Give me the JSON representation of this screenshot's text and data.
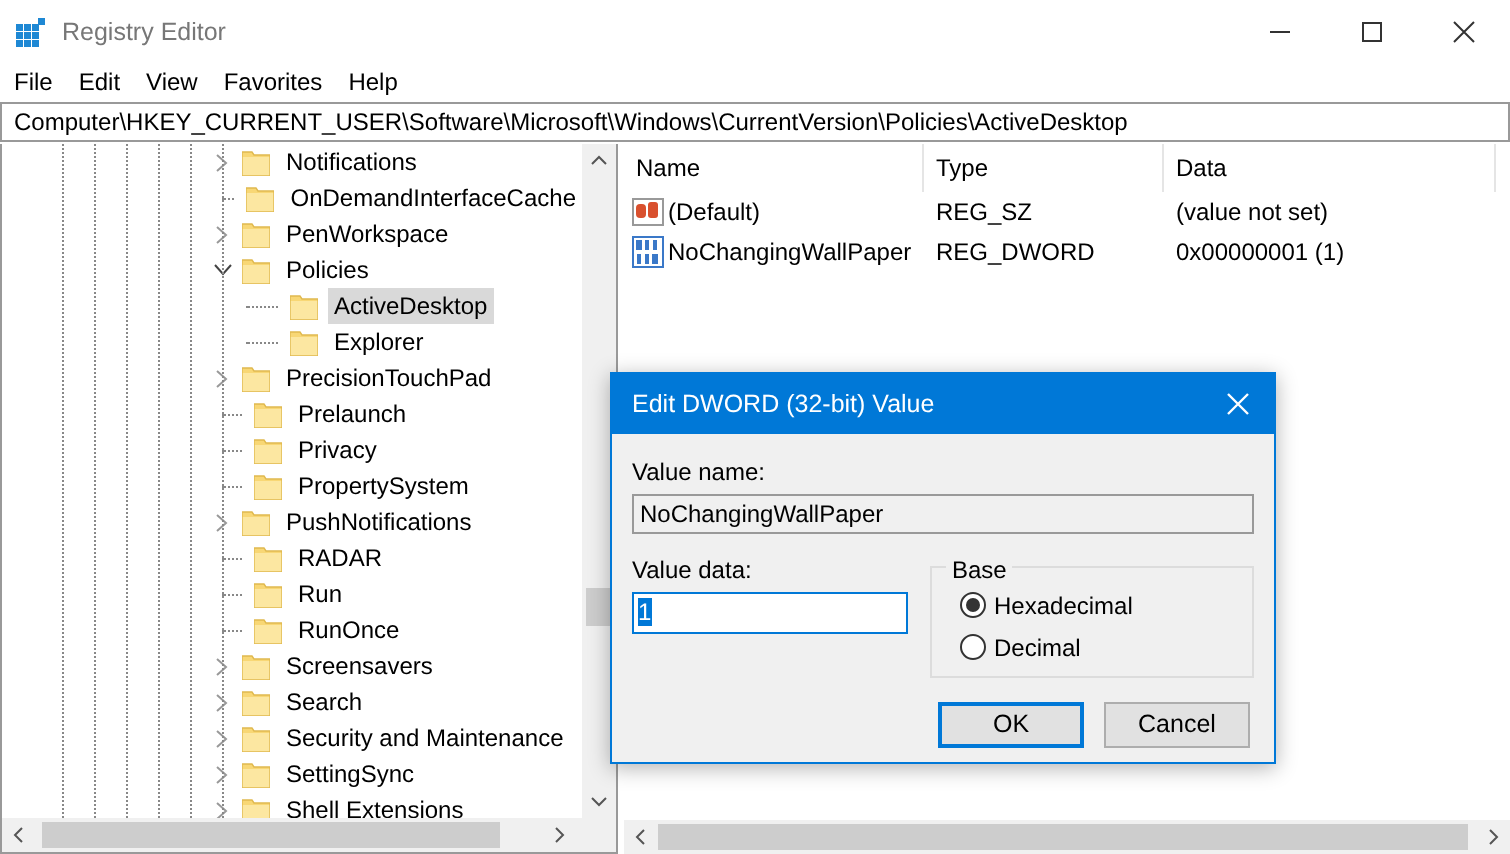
{
  "window": {
    "title": "Registry Editor"
  },
  "menu": [
    "File",
    "Edit",
    "View",
    "Favorites",
    "Help"
  ],
  "address": "Computer\\HKEY_CURRENT_USER\\Software\\Microsoft\\Windows\\CurrentVersion\\Policies\\ActiveDesktop",
  "tree": [
    {
      "label": "Notifications",
      "expandable": true,
      "expanded": false,
      "selected": false
    },
    {
      "label": "OnDemandInterfaceCache",
      "expandable": false,
      "selected": false
    },
    {
      "label": "PenWorkspace",
      "expandable": true,
      "expanded": false,
      "selected": false
    },
    {
      "label": "Policies",
      "expandable": true,
      "expanded": true,
      "selected": false,
      "children": [
        {
          "label": "ActiveDesktop",
          "expandable": false,
          "selected": true
        },
        {
          "label": "Explorer",
          "expandable": false,
          "selected": false
        }
      ]
    },
    {
      "label": "PrecisionTouchPad",
      "expandable": true,
      "expanded": false,
      "selected": false
    },
    {
      "label": "Prelaunch",
      "expandable": false,
      "selected": false
    },
    {
      "label": "Privacy",
      "expandable": false,
      "selected": false
    },
    {
      "label": "PropertySystem",
      "expandable": false,
      "selected": false
    },
    {
      "label": "PushNotifications",
      "expandable": true,
      "expanded": false,
      "selected": false
    },
    {
      "label": "RADAR",
      "expandable": false,
      "selected": false
    },
    {
      "label": "Run",
      "expandable": false,
      "selected": false
    },
    {
      "label": "RunOnce",
      "expandable": false,
      "selected": false
    },
    {
      "label": "Screensavers",
      "expandable": true,
      "expanded": false,
      "selected": false
    },
    {
      "label": "Search",
      "expandable": true,
      "expanded": false,
      "selected": false
    },
    {
      "label": "Security and Maintenance",
      "expandable": true,
      "expanded": false,
      "selected": false
    },
    {
      "label": "SettingSync",
      "expandable": true,
      "expanded": false,
      "selected": false
    },
    {
      "label": "Shell Extensions",
      "expandable": true,
      "expanded": false,
      "selected": false
    }
  ],
  "values": {
    "columns": [
      "Name",
      "Type",
      "Data"
    ],
    "rows": [
      {
        "kind": "string",
        "name": "(Default)",
        "type": "REG_SZ",
        "data": "(value not set)"
      },
      {
        "kind": "dword",
        "name": "NoChangingWallPaper",
        "type": "REG_DWORD",
        "data": "0x00000001 (1)"
      }
    ]
  },
  "dialog": {
    "title": "Edit DWORD (32-bit) Value",
    "value_name_label": "Value name:",
    "value_name": "NoChangingWallPaper",
    "value_data_label": "Value data:",
    "value_data": "1",
    "value_data_selected": true,
    "base": {
      "label": "Base",
      "options": [
        {
          "label": "Hexadecimal",
          "selected": true
        },
        {
          "label": "Decimal",
          "selected": false
        }
      ]
    },
    "buttons": [
      {
        "label": "OK",
        "default": true
      },
      {
        "label": "Cancel",
        "default": false
      }
    ]
  }
}
